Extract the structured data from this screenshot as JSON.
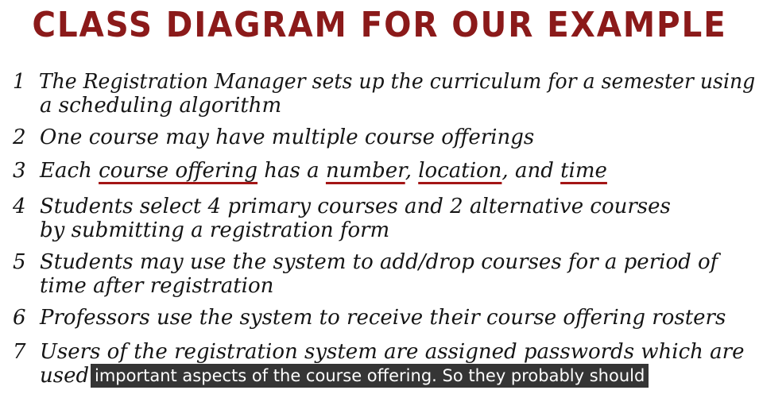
{
  "title": "CLASS DIAGRAM FOR OUR EXAMPLE",
  "items": [
    {
      "num": "1",
      "line1": "The Registration Manager sets up the curriculum for a semester using",
      "line2": "a scheduling algorithm"
    },
    {
      "num": "2",
      "line1": "One course may have multiple course offerings"
    },
    {
      "num": "3",
      "pre": "Each ",
      "u1": "course offering",
      "mid1": " has a ",
      "u2": "number",
      "mid2": ", ",
      "u3": "location",
      "mid3": ", and ",
      "u4": "time"
    },
    {
      "num": "4",
      "line1": "Students select 4 primary courses and 2 alternative courses",
      "line2": "by submitting a registration form"
    },
    {
      "num": "5",
      "line1": "Students may use the system to add/drop courses for a period of",
      "line2": "time after registration"
    },
    {
      "num": "6",
      "line1": "Professors use the system to receive their course offering rosters"
    },
    {
      "num": "7",
      "line1": "Users of the registration system are assigned passwords which are",
      "line2": "used"
    }
  ],
  "subtitle": "important aspects of the course offering. So they probably should"
}
